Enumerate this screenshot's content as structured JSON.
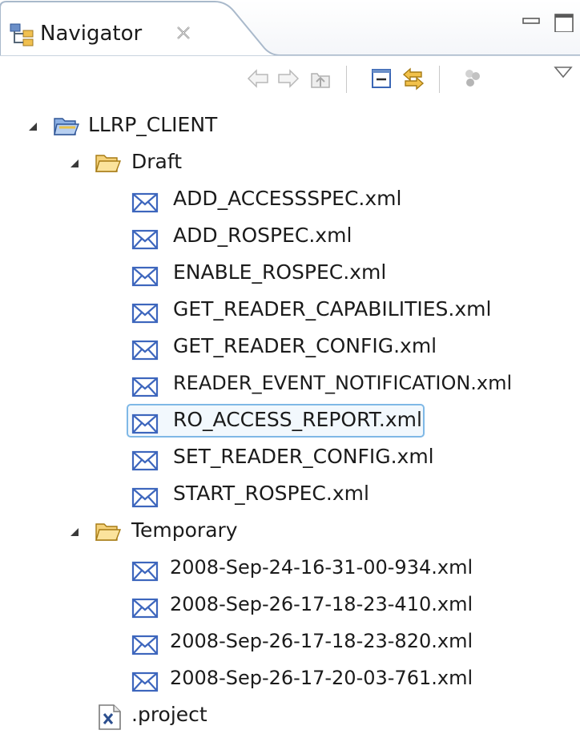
{
  "view": {
    "tab_title": "Navigator",
    "tab_close_glyph": "✕",
    "icons": {
      "tab": "navigator-view-icon",
      "minimize": "minimize-icon",
      "maximize": "maximize-icon",
      "back": "back-arrow-icon",
      "forward": "forward-arrow-icon",
      "up": "up-folder-icon",
      "collapse_all": "collapse-all-icon",
      "link_editor": "link-with-editor-icon",
      "filters": "filters-icon",
      "view_menu": "view-menu-chevron-icon"
    }
  },
  "colors": {
    "selection_border": "#7fb8e6",
    "selection_fill": "#f2f8fd",
    "folder": "#f0c050",
    "project_folder": "#6b9ad6",
    "envelope": "#4a74c9"
  },
  "tree": {
    "project": {
      "label": "LLRP_CLIENT",
      "icon": "project-folder-icon",
      "expanded": true
    },
    "folders": [
      {
        "label": "Draft",
        "icon": "open-folder-icon",
        "expanded": true,
        "files": [
          {
            "label": "ADD_ACCESSSPEC.xml",
            "icon": "message-envelope-icon"
          },
          {
            "label": "ADD_ROSPEC.xml",
            "icon": "message-envelope-icon"
          },
          {
            "label": "ENABLE_ROSPEC.xml",
            "icon": "message-envelope-icon"
          },
          {
            "label": "GET_READER_CAPABILITIES.xml",
            "icon": "message-envelope-icon"
          },
          {
            "label": "GET_READER_CONFIG.xml",
            "icon": "message-envelope-icon"
          },
          {
            "label": "READER_EVENT_NOTIFICATION.xml",
            "icon": "message-envelope-icon"
          },
          {
            "label": "RO_ACCESS_REPORT.xml",
            "icon": "message-envelope-icon",
            "selected": true
          },
          {
            "label": "SET_READER_CONFIG.xml",
            "icon": "message-envelope-icon"
          },
          {
            "label": "START_ROSPEC.xml",
            "icon": "message-envelope-icon"
          }
        ]
      },
      {
        "label": "Temporary",
        "icon": "open-folder-icon",
        "expanded": true,
        "files": [
          {
            "label": "2008-Sep-24-16-31-00-934.xml",
            "icon": "message-envelope-icon"
          },
          {
            "label": "2008-Sep-26-17-18-23-410.xml",
            "icon": "message-envelope-icon"
          },
          {
            "label": "2008-Sep-26-17-18-23-820.xml",
            "icon": "message-envelope-icon"
          },
          {
            "label": "2008-Sep-26-17-20-03-761.xml",
            "icon": "message-envelope-icon"
          }
        ]
      }
    ],
    "project_file": {
      "label": ".project",
      "icon": "xml-file-icon"
    }
  }
}
